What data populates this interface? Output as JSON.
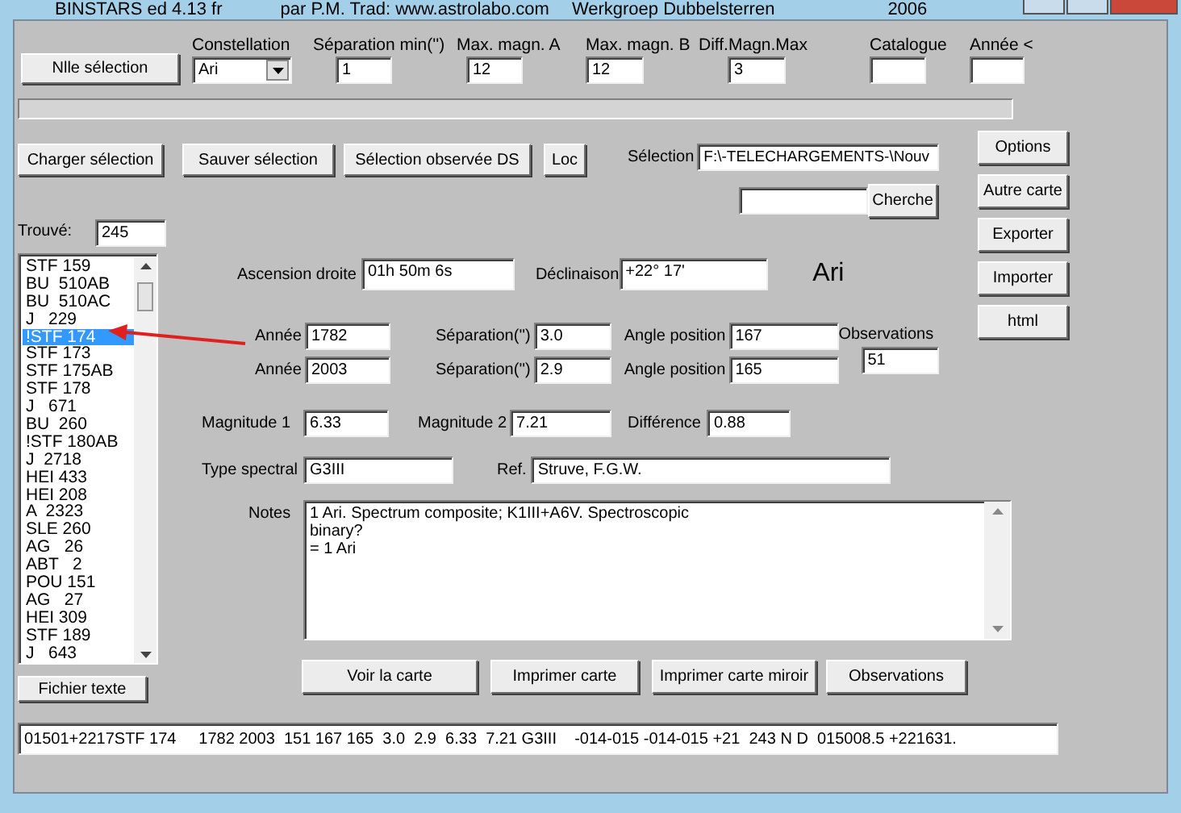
{
  "window": {
    "title": "BINSTARS ed 4.13 fr",
    "credits": "par P.M. Trad: www.astrolabo.com",
    "group": "Werkgroep Dubbelsterren",
    "year": "2006"
  },
  "filters": {
    "button": "Nlle sélection",
    "fields": [
      {
        "kind": "select",
        "label": "Constellation",
        "value": "Ari"
      },
      {
        "kind": "text",
        "label": "Séparation min('')",
        "value": "1"
      },
      {
        "kind": "text",
        "label": "Max. magn. A",
        "value": "12"
      },
      {
        "kind": "text",
        "label": "Max. magn. B",
        "value": "12"
      },
      {
        "kind": "text",
        "label": "Diff.Magn.Max",
        "value": "3"
      },
      {
        "kind": "text",
        "label": "Catalogue"
      },
      {
        "kind": "text",
        "label": "Année <"
      }
    ]
  },
  "progress": {
    "level": 0
  },
  "selection_bar": {
    "buttons": [
      "Charger sélection",
      "Sauver sélection",
      "Sélection observée DS",
      "Loc"
    ],
    "label": "Sélection",
    "path": "F:\\-TELECHARGEMENTS-\\Nouv"
  },
  "search": {
    "button": "Cherche"
  },
  "side_buttons": [
    "Options",
    "Autre carte",
    "Exporter",
    "Importer",
    "html"
  ],
  "results": {
    "label": "Trouvé:",
    "count": "245",
    "button": "Fichier texte",
    "items": [
      {
        "name": "STF 159",
        "selected": false
      },
      {
        "name": "BU  510AB",
        "selected": false
      },
      {
        "name": "BU  510AC",
        "selected": false
      },
      {
        "name": "J   229",
        "selected": false
      },
      {
        "name": "!STF 174",
        "selected": true
      },
      {
        "name": "STF 173",
        "selected": false
      },
      {
        "name": "STF 175AB",
        "selected": false
      },
      {
        "name": "STF 178",
        "selected": false
      },
      {
        "name": "J   671",
        "selected": false
      },
      {
        "name": "BU  260",
        "selected": false
      },
      {
        "name": "!STF 180AB",
        "selected": false
      },
      {
        "name": "J  2718",
        "selected": false
      },
      {
        "name": "HEI 433",
        "selected": false
      },
      {
        "name": "HEI 208",
        "selected": false
      },
      {
        "name": "A  2323",
        "selected": false
      },
      {
        "name": "SLE 260",
        "selected": false
      },
      {
        "name": "AG   26",
        "selected": false
      },
      {
        "name": "ABT   2",
        "selected": false
      },
      {
        "name": "POU 151",
        "selected": false
      },
      {
        "name": "AG   27",
        "selected": false
      },
      {
        "name": "HEI 309",
        "selected": false
      },
      {
        "name": "STF 189",
        "selected": false
      },
      {
        "name": "J   643",
        "selected": false
      }
    ]
  },
  "details": {
    "ascension": {
      "label": "Ascension droite",
      "value": "01h 50m 6s"
    },
    "declination": {
      "label": "Déclinaison",
      "value": "+22° 17'"
    },
    "constellation": "Ari",
    "measures": [
      {
        "year_label": "Année",
        "year": "1782",
        "sep_label": "Séparation('')",
        "sep": "3.0",
        "angle_label": "Angle position",
        "angle": "167"
      },
      {
        "year_label": "Année",
        "year": "2003",
        "sep_label": "Séparation('')",
        "sep": "2.9",
        "angle_label": "Angle position",
        "angle": "165"
      }
    ],
    "observations": {
      "label": "Observations",
      "value": "51"
    },
    "magnitude1": {
      "label": "Magnitude 1",
      "value": "6.33"
    },
    "magnitude2": {
      "label": "Magnitude 2",
      "value": "7.21"
    },
    "difference": {
      "label": "Différence",
      "value": "0.88"
    },
    "spectral": {
      "label": "Type spectral",
      "value": "G3III"
    },
    "ref": {
      "label": "Ref.",
      "value": "Struve, F.G.W."
    },
    "notes": {
      "label": "Notes",
      "lines": [
        "1 Ari. Spectrum composite; K1III+A6V. Spectroscopic",
        "binary?",
        "= 1 Ari"
      ]
    }
  },
  "actions": [
    "Voir la carte",
    "Imprimer carte",
    "Imprimer carte miroir",
    "Observations"
  ],
  "record": "01501+2217STF 174     1782 2003  151 167 165  3.0  2.9  6.33  7.21 G3III    -014-015 -014-015 +21  243 N D  015008.5 +221631."
}
